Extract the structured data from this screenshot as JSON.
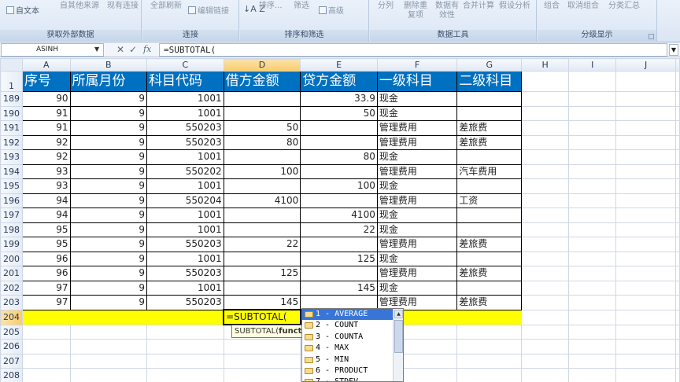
{
  "ribbon": {
    "groups": [
      {
        "caption": "获取外部数据",
        "buttons": [
          "自文本",
          "自其他来源",
          "现有连接"
        ]
      },
      {
        "caption": "连接",
        "buttons": [
          "全部刷新",
          "编辑链接"
        ]
      },
      {
        "caption": "排序和筛选",
        "buttons": [
          "排序...",
          "筛选",
          "高级"
        ]
      },
      {
        "caption": "数据工具",
        "buttons": [
          "分列",
          "删除重复项",
          "数据有效性",
          "合并计算",
          "假设分析"
        ]
      },
      {
        "caption": "分级显示",
        "buttons": [
          "组合",
          "取消组合",
          "分类汇总"
        ]
      }
    ]
  },
  "formula_bar": {
    "name_box": "ASINH",
    "formula": "=SUBTOTAL(",
    "cancel_icon": "close-icon",
    "enter_icon": "check-icon",
    "fx_label": "fx"
  },
  "sheet": {
    "columns": [
      "A",
      "B",
      "C",
      "D",
      "E",
      "F",
      "G",
      "H",
      "I",
      "J"
    ],
    "header_row_number": "1",
    "headers": [
      "序号",
      "所属月份",
      "科目代码",
      "借方金额",
      "贷方金额",
      "一级科目",
      "二级科目"
    ],
    "rows": [
      {
        "row": "189",
        "cells": [
          "90",
          "9",
          "1001",
          "",
          "33.9",
          "现金",
          ""
        ]
      },
      {
        "row": "190",
        "cells": [
          "91",
          "9",
          "1001",
          "",
          "50",
          "现金",
          ""
        ]
      },
      {
        "row": "191",
        "cells": [
          "91",
          "9",
          "550203",
          "50",
          "",
          "管理费用",
          "差旅费"
        ]
      },
      {
        "row": "192",
        "cells": [
          "92",
          "9",
          "550203",
          "80",
          "",
          "管理费用",
          "差旅费"
        ]
      },
      {
        "row": "193",
        "cells": [
          "92",
          "9",
          "1001",
          "",
          "80",
          "现金",
          ""
        ]
      },
      {
        "row": "194",
        "cells": [
          "93",
          "9",
          "550202",
          "100",
          "",
          "管理费用",
          "汽车费用"
        ]
      },
      {
        "row": "195",
        "cells": [
          "93",
          "9",
          "1001",
          "",
          "100",
          "现金",
          ""
        ]
      },
      {
        "row": "196",
        "cells": [
          "94",
          "9",
          "550204",
          "4100",
          "",
          "管理费用",
          "工资"
        ]
      },
      {
        "row": "197",
        "cells": [
          "94",
          "9",
          "1001",
          "",
          "4100",
          "现金",
          ""
        ]
      },
      {
        "row": "198",
        "cells": [
          "95",
          "9",
          "1001",
          "",
          "22",
          "现金",
          ""
        ]
      },
      {
        "row": "199",
        "cells": [
          "95",
          "9",
          "550203",
          "22",
          "",
          "管理费用",
          "差旅费"
        ]
      },
      {
        "row": "200",
        "cells": [
          "96",
          "9",
          "1001",
          "",
          "125",
          "现金",
          ""
        ]
      },
      {
        "row": "201",
        "cells": [
          "96",
          "9",
          "550203",
          "125",
          "",
          "管理费用",
          "差旅费"
        ]
      },
      {
        "row": "202",
        "cells": [
          "97",
          "9",
          "1001",
          "",
          "145",
          "现金",
          ""
        ]
      },
      {
        "row": "203",
        "cells": [
          "97",
          "9",
          "550203",
          "145",
          "",
          "管理费用",
          "差旅费"
        ]
      }
    ],
    "editing_row": "204",
    "editing_cell_text": "=SUBTOTAL(",
    "empty_rows": [
      "205",
      "206",
      "207",
      "208"
    ],
    "header_fill": "#0070c0",
    "highlight_fill": "#ffff00"
  },
  "tooltip": {
    "prefix": "SUBTOTAL(",
    "bold": "funct"
  },
  "autocomplete": {
    "items": [
      "1 - AVERAGE",
      "2 - COUNT",
      "3 - COUNTA",
      "4 - MAX",
      "5 - MIN",
      "6 - PRODUCT",
      "7 - STDEV"
    ],
    "selected_index": 0,
    "selection_color": "#3875d7"
  }
}
